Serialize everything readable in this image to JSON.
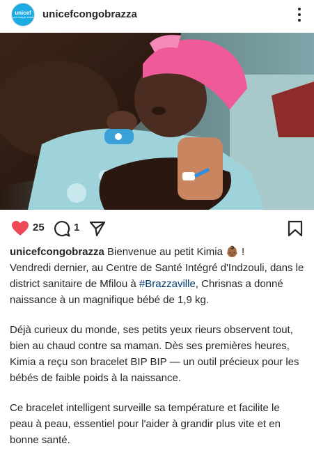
{
  "post": {
    "username": "unicefcongobrazza",
    "avatar": {
      "brand": "unicef",
      "sub": "pour chaque enfant"
    },
    "likes_count": "25",
    "comments_count": "1",
    "caption": {
      "username": "unicefcongobrazza",
      "line1": "Bienvenue au petit Kimia",
      "emoji": "👶🏾",
      "line1_end": "!",
      "p1_before_tag": "Vendredi dernier, au Centre de Santé Intégré d'Indzouli, dans le district sanitaire de Mfilou à ",
      "hashtag": "#Brazzaville",
      "p1_after_tag": ", Chrisnas a donné naissance à un magnifique bébé de 1,9 kg.",
      "p2": "Déjà curieux du monde, ses petits yeux rieurs observent tout, bien au chaud contre sa maman. Dès ses premières heures, Kimia a reçu son bracelet BIP BIP — un outil précieux pour les bébés de faible poids à la naissance.",
      "p3": "Ce bracelet intelligent surveille sa température et facilite le peau à peau, essentiel pour l'aider à grandir plus vite et en bonne santé."
    }
  },
  "icons": {
    "more": "more-options-icon",
    "like": "heart-icon",
    "comment": "comment-icon",
    "share": "share-icon",
    "save": "bookmark-icon"
  },
  "colors": {
    "like_red": "#ed4956",
    "hashtag": "#00376b",
    "unicef_blue": "#1cabe2"
  }
}
